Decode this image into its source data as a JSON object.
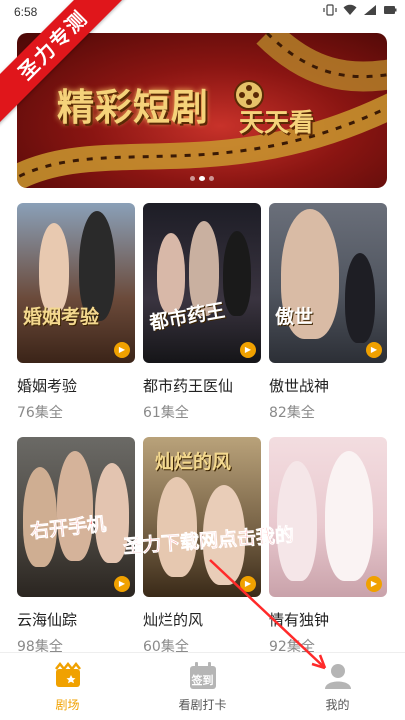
{
  "status_bar": {
    "time": "6:58",
    "battery": "68%"
  },
  "watermark": "圣力专测",
  "banner": {
    "title": "精彩短剧",
    "subtitle": "天天看",
    "dots": 3,
    "active_dot": 1
  },
  "dramas": [
    {
      "title": "婚姻考验",
      "episodes": "76集全",
      "poster_text": "婚姻考验",
      "bg": "#6b4a3a"
    },
    {
      "title": "都市药王医仙",
      "episodes": "61集全",
      "poster_text": "都市药王",
      "bg": "#2a2a35"
    },
    {
      "title": "傲世战神",
      "episodes": "82集全",
      "poster_text": "傲世",
      "bg": "#50555f"
    },
    {
      "title": "云海仙踪",
      "episodes": "98集全",
      "poster_text": "",
      "bg": "#4a4640"
    },
    {
      "title": "灿烂的风",
      "episodes": "60集全",
      "poster_text": "灿烂的风",
      "bg": "#7a6548"
    },
    {
      "title": "情有独钟",
      "episodes": "92集全",
      "poster_text": "",
      "bg": "#e9c9cf"
    }
  ],
  "overlay": {
    "line1": "右开手机",
    "line2": "圣力下载网点击我的"
  },
  "tabs": [
    {
      "label": "剧场",
      "icon": "theater-icon",
      "active": true
    },
    {
      "label": "看剧打卡",
      "icon": "checkin-icon",
      "badge": "签到",
      "active": false
    },
    {
      "label": "我的",
      "icon": "profile-icon",
      "active": false
    }
  ],
  "colors": {
    "accent": "#f0a100",
    "watermark_red": "#e0161b",
    "banner_red": "#8a1512"
  }
}
